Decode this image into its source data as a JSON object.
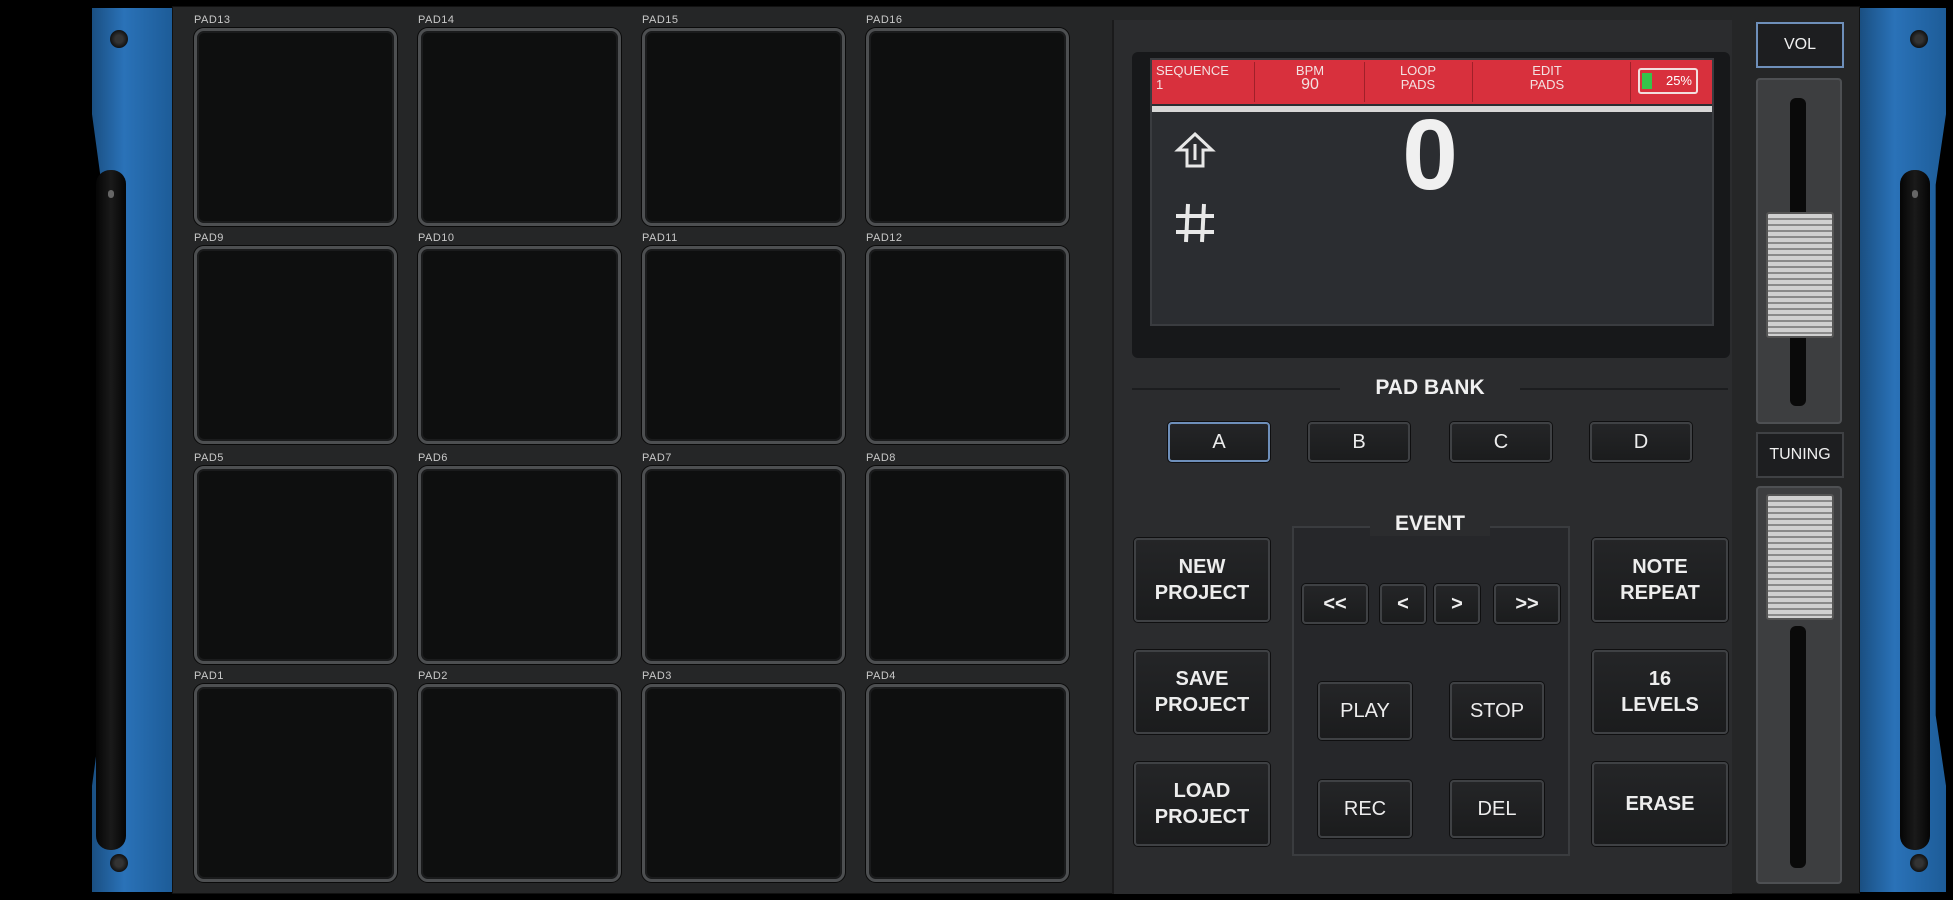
{
  "pads": [
    {
      "label": "PAD13"
    },
    {
      "label": "PAD14"
    },
    {
      "label": "PAD15"
    },
    {
      "label": "PAD16"
    },
    {
      "label": "PAD9"
    },
    {
      "label": "PAD10"
    },
    {
      "label": "PAD11"
    },
    {
      "label": "PAD12"
    },
    {
      "label": "PAD5"
    },
    {
      "label": "PAD6"
    },
    {
      "label": "PAD7"
    },
    {
      "label": "PAD8"
    },
    {
      "label": "PAD1"
    },
    {
      "label": "PAD2"
    },
    {
      "label": "PAD3"
    },
    {
      "label": "PAD4"
    }
  ],
  "display": {
    "sequence_label": "SEQUENCE",
    "sequence_value": "1",
    "bpm_label": "BPM",
    "bpm_value": "90",
    "loop_pads": "LOOP\nPADS",
    "edit_pads": "EDIT\nPADS",
    "battery": "25%",
    "counter": "0",
    "icons": [
      "up-arrow-icon",
      "grid-hash-icon"
    ]
  },
  "pad_bank": {
    "title": "PAD BANK",
    "banks": [
      "A",
      "B",
      "C",
      "D"
    ],
    "selected": "A"
  },
  "event": {
    "title": "EVENT",
    "nav": [
      "<<",
      "<",
      ">",
      ">>"
    ],
    "play": "PLAY",
    "stop": "STOP",
    "rec": "REC",
    "del": "DEL"
  },
  "left_buttons": {
    "new": "NEW\nPROJECT",
    "save": "SAVE\nPROJECT",
    "load": "LOAD\nPROJECT"
  },
  "right_buttons": {
    "note_repeat": "NOTE\nREPEAT",
    "levels": "16\nLEVELS",
    "erase": "ERASE"
  },
  "sliders": {
    "vol_label": "VOL",
    "tuning_label": "TUNING"
  },
  "colors": {
    "accent": "#d8303d",
    "rack_blue": "#2a72b8",
    "bank_selected_border": "#6e8fba"
  }
}
